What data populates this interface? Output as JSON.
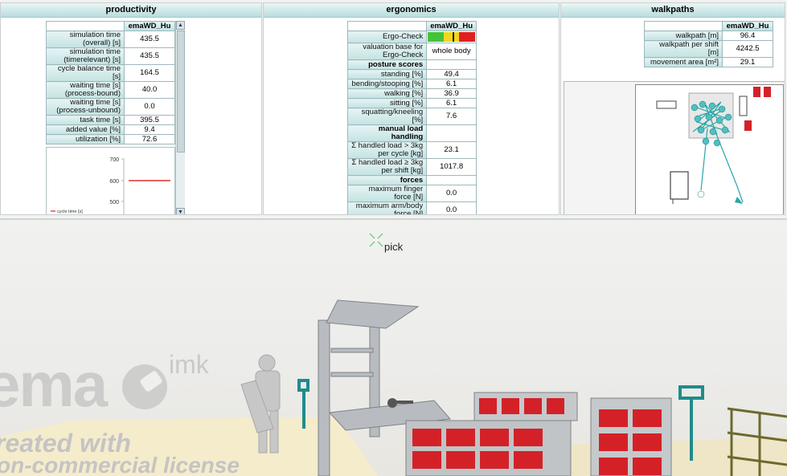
{
  "productivity": {
    "title": "productivity",
    "column_header": "emaWD_Hu",
    "rows": [
      {
        "label": "simulation time (overall) [s]",
        "value": "435.5"
      },
      {
        "label": "simulation time (timerelevant) [s]",
        "value": "435.5"
      },
      {
        "label": "cycle balance time [s]",
        "value": "164.5"
      },
      {
        "label": "waiting time [s] (process-bound)",
        "value": "40.0"
      },
      {
        "label": "waiting time [s] (process-unbound)",
        "value": "0.0"
      },
      {
        "label": "task time [s]",
        "value": "395.5"
      },
      {
        "label": "added value [%]",
        "value": "9.4"
      },
      {
        "label": "utilization [%]",
        "value": "72.6"
      }
    ],
    "mini_chart": {
      "ticks": [
        "700",
        "600",
        "500"
      ],
      "legend": "cycle time [s]",
      "series_value": 600,
      "color": "#e03030"
    }
  },
  "ergonomics": {
    "title": "ergonomics",
    "column_header": "emaWD_Hu",
    "ergo_check_label": "Ergo-Check",
    "ergo_colors": [
      "#46c23a",
      "#f0d81a",
      "#e02020"
    ],
    "valuation_label": "valuation base for Ergo-Check",
    "valuation_value": "whole body",
    "posture_header": "posture scores",
    "posture": [
      {
        "label": "standing [%]",
        "value": "49.4"
      },
      {
        "label": "bending/stooping [%]",
        "value": "6.1"
      },
      {
        "label": "walking [%]",
        "value": "36.9"
      },
      {
        "label": "sitting [%]",
        "value": "6.1"
      },
      {
        "label": "squatting/kneeling [%]",
        "value": "7.6"
      }
    ],
    "load_header": "manual load handling",
    "load": [
      {
        "label": "Σ handled load > 3kg per cycle [kg]",
        "value": "23.1"
      },
      {
        "label": "Σ handled load ≥ 3kg per shift [kg]",
        "value": "1017.8"
      }
    ],
    "forces_header": "forces",
    "forces": [
      {
        "label": "maximum finger force [N]",
        "value": "0.0"
      },
      {
        "label": "maximum arm/body force [N]",
        "value": "0.0"
      }
    ]
  },
  "walkpaths": {
    "title": "walkpaths",
    "column_header": "emaWD_Hu",
    "rows": [
      {
        "label": "walkpath [m]",
        "value": "96.4"
      },
      {
        "label": "walkpath per shift [m]",
        "value": "4242.5"
      },
      {
        "label": "movement area [m²]",
        "value": "29.1"
      }
    ]
  },
  "scene": {
    "pick_label": "pick",
    "watermark_brand": "ema",
    "watermark_sub": "imk",
    "watermark_line1": "reated with",
    "watermark_line2": "on-commercial license"
  },
  "colors": {
    "header_teal": "#b9dcdc",
    "path_teal": "#2aa6a6",
    "bin_red": "#d42128"
  }
}
